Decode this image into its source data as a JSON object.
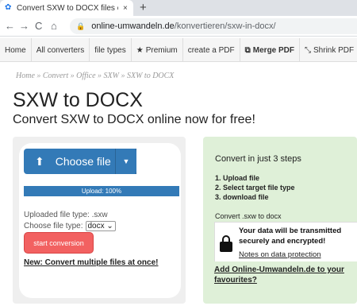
{
  "browser": {
    "tab_title": "Convert SXW to DOCX files onlin",
    "tab_close": "×",
    "new_tab": "+",
    "back": "←",
    "forward": "→",
    "reload": "C",
    "home": "⌂",
    "url_domain": "online-umwandeln.de",
    "url_path": "/konvertieren/sxw-in-docx/"
  },
  "sitenav": {
    "home": "Home",
    "all_converters": "All converters",
    "file_types": "file types",
    "premium": "Premium",
    "create_pdf": "create a PDF",
    "merge_pdf": "Merge PDF",
    "shrink_pdf": "Shrink PDF"
  },
  "breadcrumb": "Home » Convert » Office » SXW » SXW to DOCX",
  "page": {
    "title": "SXW to DOCX",
    "subtitle": "Convert SXW to DOCX online now for free!"
  },
  "upload": {
    "choose_file": "Choose file",
    "progress_label": "Upload: 100%",
    "progress_fraction": 1.0,
    "uploaded_type": "Uploaded file type: .sxw",
    "choose_type_label": "Choose file type:",
    "selected_type": "docx",
    "start_button": "start conversion",
    "multi_link": "New: Convert multiple files at once!"
  },
  "steps": {
    "title": "Convert in just 3 steps",
    "step1": "1. Upload file",
    "step2": "2. Select target file type",
    "step3": "3. download file",
    "convert_title": "Convert .sxw to docx",
    "secure_text": "Your data will be transmitted securely and encrypted!",
    "privacy_link": "Notes on data protection",
    "favourites_link": "Add Online-Umwandeln.de to your favourites?"
  },
  "colors": {
    "primary": "#337ab7",
    "start_button": "#f26161",
    "steps_panel": "#dff0d8"
  }
}
